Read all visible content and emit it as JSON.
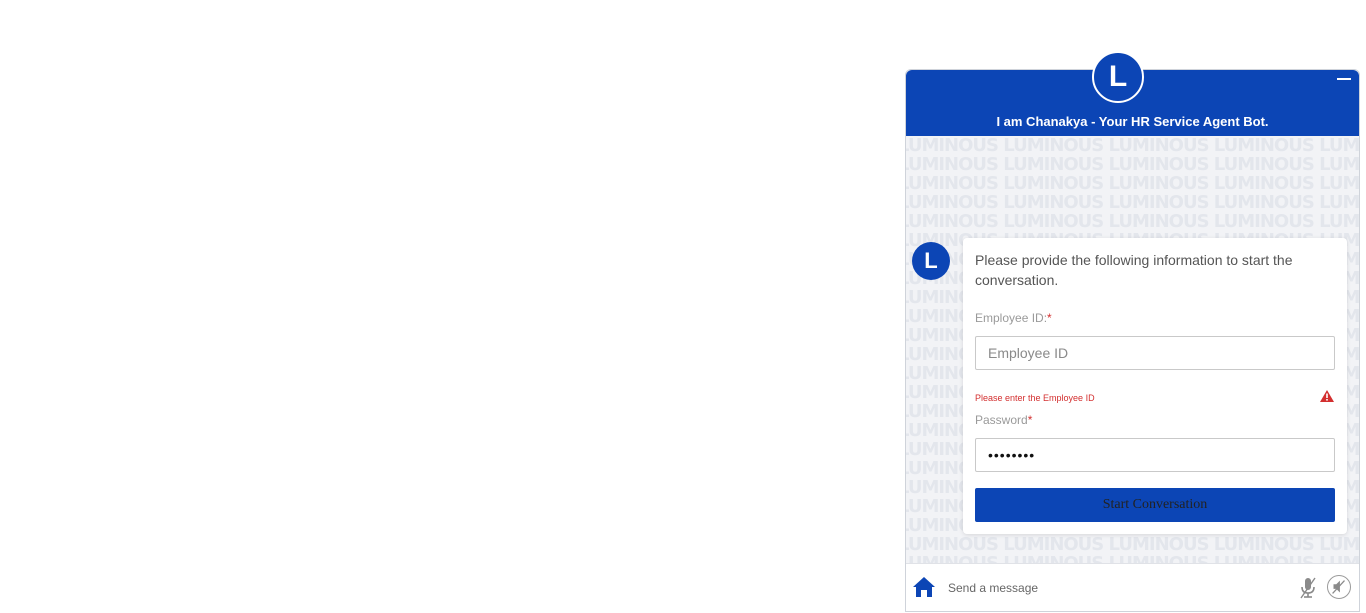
{
  "header": {
    "avatar_letter": "L",
    "title": "I am Chanakya - Your HR Service Agent Bot.",
    "color": "#0c45b5"
  },
  "chat": {
    "watermark_text": "LUMINOUS",
    "bot_avatar_letter": "L",
    "intro_text": "Please provide the following information to start the conversation."
  },
  "form": {
    "employee_id_label": "Employee ID:",
    "employee_id_required": "*",
    "employee_id_placeholder": "Employee ID",
    "employee_id_value": "",
    "employee_id_error": "Please enter the Employee ID",
    "password_label": "Password",
    "password_required": "*",
    "password_value": "••••••••",
    "submit_label": "Start Conversation"
  },
  "footer": {
    "message_placeholder": "Send a message"
  },
  "colors": {
    "accent": "#0c45b5",
    "error": "#d32f2f"
  },
  "icons": {
    "minimize": "minimize-icon",
    "warning": "warning-icon",
    "home": "home-icon",
    "microphone": "microphone-icon",
    "mute": "speaker-mute-icon"
  }
}
